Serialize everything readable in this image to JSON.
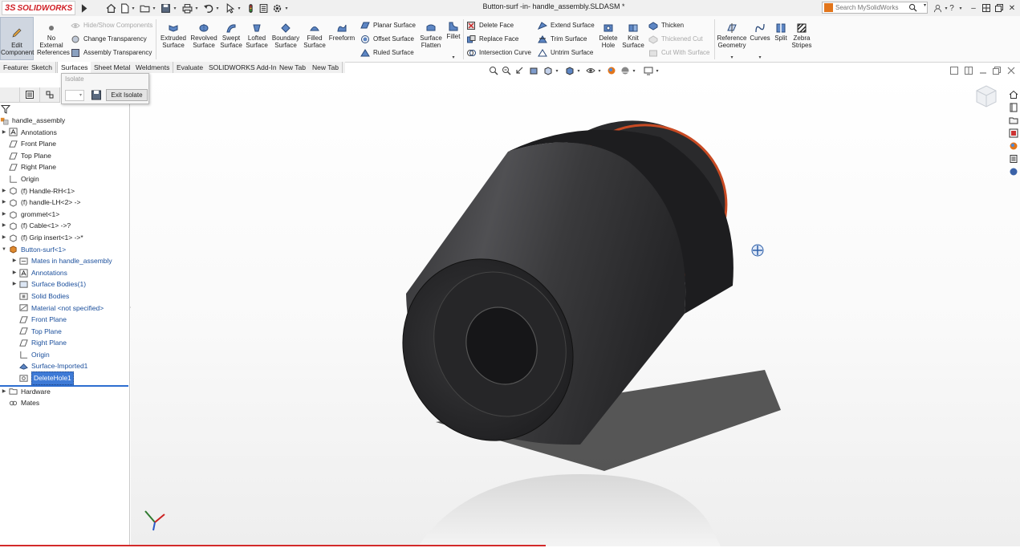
{
  "app": {
    "logo_text": "SOLIDWORKS",
    "logo_prefix": "3S",
    "document_title": "Button-surf -in- handle_assembly.SLDASM *",
    "search_placeholder": "Search MySolidWorks"
  },
  "ribbon": {
    "edit_component": "Edit Component",
    "no_external_references": "No External References",
    "hide_show_components": "Hide/Show Components",
    "change_transparency": "Change Transparency",
    "assembly_transparency": "Assembly Transparency",
    "extruded_surface": "Extruded Surface",
    "revolved_surface": "Revolved Surface",
    "swept_surface": "Swept Surface",
    "lofted_surface": "Lofted Surface",
    "boundary_surface": "Boundary Surface",
    "filled_surface": "Filled Surface",
    "freeform": "Freeform",
    "planar_surface": "Planar Surface",
    "offset_surface": "Offset Surface",
    "ruled_surface": "Ruled Surface",
    "surface_flatten": "Surface Flatten",
    "fillet": "Fillet",
    "delete_face": "Delete Face",
    "replace_face": "Replace Face",
    "intersection_curve": "Intersection Curve",
    "extend_surface": "Extend Surface",
    "trim_surface": "Trim Surface",
    "untrim_surface": "Untrim Surface",
    "delete_hole": "Delete Hole",
    "knit_surface": "Knit Surface",
    "thicken": "Thicken",
    "thickened_cut": "Thickened Cut",
    "cut_with_surface": "Cut With Surface",
    "reference_geometry": "Reference Geometry",
    "curves": "Curves",
    "split": "Split",
    "zebra_stripes": "Zebra Stripes"
  },
  "tabs": [
    "Features",
    "Sketch",
    "Surfaces",
    "Sheet Metal",
    "Weldments",
    "Evaluate",
    "SOLIDWORKS Add-Ins",
    "New Tab",
    "New Tab"
  ],
  "active_tab": "Surfaces",
  "isolate_popup": {
    "title": "Isolate",
    "exit_label": "Exit Isolate"
  },
  "tree": {
    "root": "handle_assembly",
    "items": [
      "Annotations",
      "Front Plane",
      "Top Plane",
      "Right Plane",
      "Origin",
      "(f) Handle-RH<1>",
      "(f) handle-LH<2> ->",
      "grommet<1>",
      "(f) Cable<1> ->?",
      "(f) Grip insert<1> ->*",
      "Button-surf<1>"
    ],
    "children": [
      "Mates in handle_assembly",
      "Annotations",
      "Surface Bodies(1)",
      "Solid Bodies",
      "Material <not specified>",
      "Front Plane",
      "Top Plane",
      "Right Plane",
      "Origin",
      "Surface-Imported1",
      "DeleteHole1"
    ],
    "tail": [
      "Hardware",
      "Mates"
    ]
  },
  "colors": {
    "brand_red": "#d01f26",
    "selection_blue": "#3e7ad6",
    "component_orange": "#e08a2e",
    "child_text_blue": "#1b4f9c"
  }
}
